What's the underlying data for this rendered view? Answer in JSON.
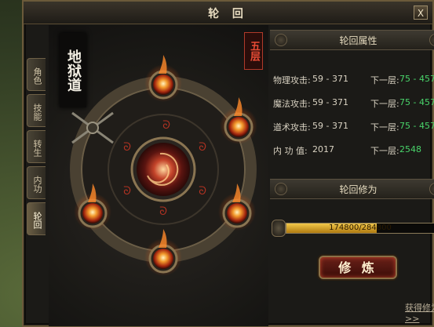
{
  "window": {
    "title": "轮 回",
    "close_label": "X"
  },
  "tabs": [
    {
      "label": "角色"
    },
    {
      "label": "技能"
    },
    {
      "label": "转生"
    },
    {
      "label": "内功"
    },
    {
      "label": "轮回"
    }
  ],
  "left": {
    "realm_name": "地狱道",
    "level_badge": "五层"
  },
  "attributes": {
    "header": "轮回属性",
    "rows": [
      {
        "label": "物理攻击:",
        "value": "59 - 371",
        "next_label": "下一层:",
        "next_value": "75 - 457"
      },
      {
        "label": "魔法攻击:",
        "value": "59 - 371",
        "next_label": "下一层:",
        "next_value": "75 - 457"
      },
      {
        "label": "道术攻击:",
        "value": "59 - 371",
        "next_label": "下一层:",
        "next_value": "75 - 457"
      },
      {
        "label": "内 功 值:",
        "value": "2017",
        "next_label": "下一层:",
        "next_value": "2548"
      }
    ]
  },
  "cultivation": {
    "header": "轮回修为",
    "progress_text": "174800/284800",
    "progress_fraction": 0.614,
    "train_label": "修 炼",
    "get_link": "获得修为>>"
  },
  "colors": {
    "next_value": "#49d46a",
    "bar_fill": "#e0a92a",
    "badge": "#e84b35"
  }
}
